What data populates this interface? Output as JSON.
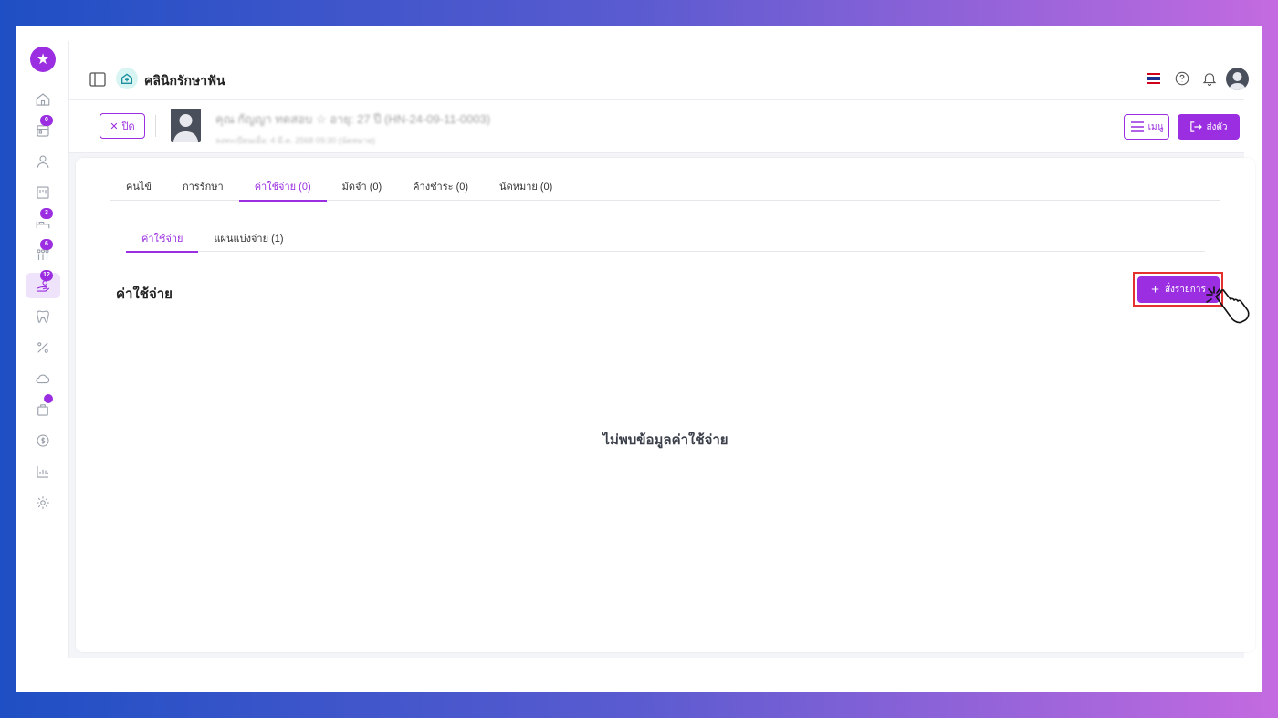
{
  "app": {
    "clinic_name": "คลินิกรักษาฟัน",
    "brand_color": "#9a2ee0"
  },
  "rail": {
    "items": [
      {
        "icon": "home-icon",
        "badge": ""
      },
      {
        "icon": "calendar-icon",
        "badge": "0"
      },
      {
        "icon": "user-icon",
        "badge": ""
      },
      {
        "icon": "board-icon",
        "badge": ""
      },
      {
        "icon": "bed-icon",
        "badge": "3"
      },
      {
        "icon": "people-icon",
        "badge": "6"
      },
      {
        "icon": "payment-hand-icon",
        "badge": "12"
      },
      {
        "icon": "tooth-icon",
        "badge": ""
      },
      {
        "icon": "percent-icon",
        "badge": ""
      },
      {
        "icon": "cloud-icon",
        "badge": ""
      },
      {
        "icon": "bag-icon",
        "badge": "dot"
      },
      {
        "icon": "dollar-icon",
        "badge": ""
      },
      {
        "icon": "chart-icon",
        "badge": ""
      },
      {
        "icon": "gear-icon",
        "badge": ""
      }
    ]
  },
  "patient": {
    "close_label": "ปิด",
    "name_line": "คุณ กัญญา ทดสอบ  ☆  อายุ: 27 ปี  (HN-24-09-11-0003)",
    "sub_line": "ลงทะเบียนเมื่อ: 4 มี.ค. 2568 09:30 (นัดหมาย)",
    "menu_label": "เมนู",
    "send_label": "ส่งตัว"
  },
  "tabs": [
    {
      "label": "คนไข้",
      "active": false
    },
    {
      "label": "การรักษา",
      "active": false
    },
    {
      "label": "ค่าใช้จ่าย (0)",
      "active": true
    },
    {
      "label": "มัดจำ (0)",
      "active": false
    },
    {
      "label": "ค้างชำระ (0)",
      "active": false
    },
    {
      "label": "นัดหมาย (0)",
      "active": false
    }
  ],
  "subtabs": [
    {
      "label": "ค่าใช้จ่าย",
      "active": true
    },
    {
      "label": "แผนแบ่งจ่าย (1)",
      "active": false
    }
  ],
  "section": {
    "title": "ค่าใช้จ่าย",
    "add_button_label": "สั่งรายการ",
    "empty_text": "ไม่พบข้อมูลค่าใช้จ่าย"
  }
}
